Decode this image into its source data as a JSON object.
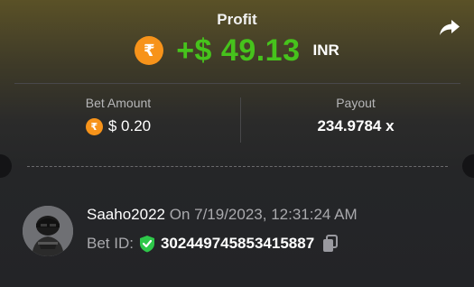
{
  "header": {
    "title": "Profit",
    "share_icon": "share-arrow-icon"
  },
  "profit": {
    "coin_symbol": "₹",
    "amount": "+$ 49.13",
    "currency": "INR",
    "amount_color": "#46c31c"
  },
  "bet": {
    "label": "Bet Amount",
    "coin_symbol": "₹",
    "value": "$ 0.20"
  },
  "payout": {
    "label": "Payout",
    "value": "234.9784 x"
  },
  "user": {
    "name": "Saaho2022",
    "date": "On 7/19/2023, 12:31:24 AM",
    "bet_id_label": "Bet ID:",
    "bet_id": "302449745853415887",
    "verified_icon": "shield-check-icon",
    "copy_icon": "copy-icon"
  },
  "colors": {
    "accent_orange": "#f7931a",
    "verified_green": "#2ec84a"
  }
}
